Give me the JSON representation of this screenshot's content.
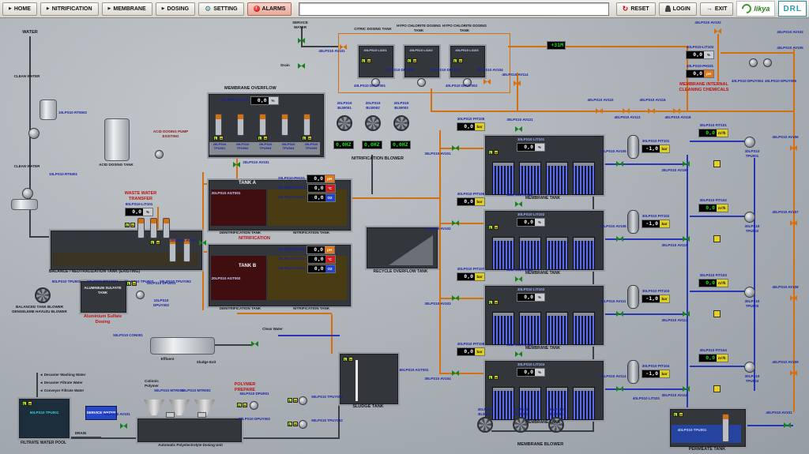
{
  "colors": {
    "pipe_orange": "#d4700f",
    "pipe_blue": "#2736b4",
    "alarm_red": "#c01010",
    "ok_green": "#18e018",
    "membrane_blue": "#5a6ae8"
  },
  "ind": {
    "l": "L",
    "h": "H"
  },
  "menubar": {
    "home": "HOME",
    "nitrification": "NITRIFICATION",
    "membrane": "MEMBRANE",
    "dosing": "DOSING",
    "setting": "SETTING",
    "alarms": "ALARMS",
    "command": "",
    "reset": "RESET",
    "login": "LOGIN",
    "exit": "EXIT",
    "brand": "likya",
    "brand2": "DRL"
  },
  "intake": {
    "water": "WATER",
    "clean_water_top": "CLEAN WATER",
    "clean_water_bottom": "CLEAN WATER",
    "rt_top": "10LPS10 RT5002",
    "rt_bottom": "10LPS10 RT5001"
  },
  "acid": {
    "tank_label": "ACID DOSING TANK",
    "pump_label": "ACID DOSING PUMP EXISTING"
  },
  "waste": {
    "title": "WASTE WATER TRANSFER",
    "lit_tag": "50LPS10-LIT101",
    "lit_value": "0,0",
    "unit": "%"
  },
  "balance": {
    "label": "BALANCE / NEUTRALIZATION TANK (EXISTING)",
    "pumps": [
      "50LPS10 TPU001",
      "50LPS10 TPUY001",
      "50LPS10 TPU002",
      "50LPS10 TPUY002"
    ],
    "blower_label": "BALANCED TANK BLOWER DENGELEME HAVUZU BLOWER"
  },
  "alum": {
    "tank_label": "ALUMINIUM SULFATE TANK",
    "dpu": "10LPS10 DPU001",
    "dpuy": "10LPS10 DPUY002",
    "title": "Aluminium Sulfate Dosing"
  },
  "overflow": {
    "title": "MEMBRANE OVERFLOW",
    "lit_tag": "20LPS10-LIT101",
    "lit_value": "0,0",
    "unit": "%",
    "pumps": [
      "20LPS10 TPU001",
      "20LPS10 TPU002",
      "20LPS10 TPU003",
      "20LPS10 TPU004",
      "20LPS10 TPU005"
    ],
    "valve": "20LPS10 AV101",
    "valve2": "20LPS10 AV102"
  },
  "bio": {
    "a": {
      "name": "TANK A",
      "agt": "20LPS10 AGT001",
      "ph_tag": "20LPS10-PH101",
      "ph": "0,0",
      "tit_tag": "20LPS10-TIT101",
      "tit": "0,0",
      "do_tag": "20LPS10-DO101",
      "dox": "0,0",
      "denit": "DENITRIFICATION TANK",
      "nit": "NITRIFICATION TANK"
    },
    "b": {
      "name": "TANK B",
      "agt": "20LPS10 AGT002",
      "ph_tag": "20LPS10-PH102",
      "ph": "0,0",
      "tit_tag": "20LPS10-TIT102",
      "tit": "0,0",
      "do_tag": "20LPS10-DO102",
      "dox": "0,0",
      "denit": "DENITRIFICATION TANK",
      "nit": "NITRIFICATION TANK"
    },
    "section": "NITRIFICATION",
    "u_ph": "pH",
    "u_c": "°C",
    "u_o2": "O2"
  },
  "nitblower": {
    "title": "NITRIFICATION BLOWER",
    "tags": [
      "20LPS10 BLW001",
      "20LPS10 BLW002",
      "20LPS10 BLW003"
    ],
    "hz": "0,0HZ"
  },
  "recycle": {
    "label": "RECYCLE OVERFLOW TANK"
  },
  "cipdose": {
    "service_water": "SERVICE WATER",
    "drain": "Drain",
    "runtime": "+31M",
    "valve_in": "40LPS10 AV101",
    "valve_out": "40LPS10 AV104",
    "valve_mid": "40LPS10 AV114",
    "tanks": [
      {
        "title": "CITRIC DOSING TANK",
        "tag": "40LPS10 L3101"
      },
      {
        "title": "HYPO CHLORITE DOSING TANK",
        "tag": "40LPS10 L3102"
      },
      {
        "title": "HYPO CHLORITE DOSING TANK",
        "tag": "40LPS10 L3103"
      }
    ],
    "dpu": [
      "40LPS10 DPU002",
      "40LPS10 DPU003"
    ],
    "dpuy": [
      "40LPS10 DPUY001",
      "40LPS10 DPUY003"
    ]
  },
  "cip": {
    "title": "MEMBRANE INTERNAL CLEANING CHEMICALS",
    "valve_top": "40LPS10 AV102",
    "lit_tag": "40LPS10-LIT102",
    "lit": "0,0",
    "u_pct": "%",
    "ph_tag": "40LPS10-PH101",
    "ph": "0,0",
    "u_ph": "pH",
    "v1": "40LPS10 AV103",
    "v2": "40LPS10 AV105",
    "dpuy1": "40LPS10 DPUY004",
    "dpuy2": "40LPS10 DPUY005",
    "line_valves": [
      "40LPS10 AV110",
      "40LPS10 AV113",
      "40LPS10 AV115",
      "40LPS10 AV116"
    ]
  },
  "mem": {
    "u_bar": "bar",
    "u_pct": "%",
    "u_flow": "m³/h",
    "rows": [
      {
        "feed": "30LPS10 AV101",
        "pit_tag": "30LPS10 PIT105",
        "pit": "0,0",
        "air": "30LPS10 AV121",
        "lit_tag": "30LPS10 LIT101",
        "lit": "0,0",
        "name": "MEMBRANE TANK",
        "ppit_tag": "30LPS10 PIT101",
        "ppit": "-1,0",
        "fit_tag": "30LPS10 FIT101",
        "flow": "0,0",
        "pump": "30LPS10 TPU001",
        "v1": "30LPS10 AV105",
        "v2": "30LPS10 AV106",
        "cipv": "40LPS10 AV106"
      },
      {
        "feed": "30LPS10 AV102",
        "pit_tag": "30LPS10 PIT106",
        "pit": "0,0",
        "air": "30LPS10 AV122",
        "lit_tag": "30LPS10 LIT102",
        "lit": "0,0",
        "name": "MEMBRANE TANK",
        "ppit_tag": "30LPS10 PIT102",
        "ppit": "-1,0",
        "fit_tag": "30LPS10 FIT102",
        "flow": "0,0",
        "pump": "30LPS10 TPU002",
        "v1": "30LPS10 AV108",
        "v2": "30LPS10 AV110",
        "cipv": "40LPS10 AV107"
      },
      {
        "feed": "30LPS10 AV103",
        "pit_tag": "30LPS10 PIT107",
        "pit": "0,0",
        "air": "30LPS10 AV123",
        "lit_tag": "30LPS10 LIT103",
        "lit": "0,0",
        "name": "MEMBRANE TANK",
        "ppit_tag": "30LPS10 PIT103",
        "ppit": "-1,0",
        "fit_tag": "30LPS10 FIT103",
        "flow": "0,0",
        "pump": "30LPS10 TPU003",
        "v1": "30LPS10 AV111",
        "v2": "30LPS10 AV113",
        "cipv": "40LPS10 AV108"
      },
      {
        "feed": "30LPS10 AV104",
        "pit_tag": "30LPS10 PIT108",
        "pit": "0,0",
        "air": "30LPS10 AV124",
        "lit_tag": "30LPS10 LIT104",
        "lit": "0,0",
        "name": "MEMBRANE TANK",
        "ppit_tag": "30LPS10 PIT104",
        "ppit": "-1,0",
        "fit_tag": "30LPS10 FIT104",
        "flow": "0,0",
        "pump": "30LPS10 TPU004",
        "v1": "30LPS10 AV114",
        "v2": "30LPS10 AV116",
        "cipv": "40LPS10 AV109"
      }
    ]
  },
  "memblower": {
    "title": "MEMBRANE BLOWER",
    "tags": [
      "30LPS10 BLW001",
      "30LPS10 BLW002",
      "30LPS10 BLW003"
    ]
  },
  "permeate": {
    "label": "PERMEATE TANK",
    "pump": "40LPS10 TPU001",
    "lit": "40LPS10 LIT101",
    "valve": "40LPS10 AV101"
  },
  "sludge": {
    "label": "SLUDGE TANK",
    "agt": "60LPS10 AGT001"
  },
  "polymer": {
    "title": "POLYMER PREPARE",
    "cationic": "Cationic Polymer",
    "mtr": [
      "50LPS10 MTR001",
      "50LPS10 MTR002"
    ],
    "dpu": "50LPS10 DPU001",
    "dpuy": "50LPS10 DPUY002",
    "tpuy": [
      "50LPS10 TPUY001",
      "50LPS10 TPUY002"
    ],
    "unit_label": "Automatic Polyelectrolyte Dosing Unit"
  },
  "decanter": {
    "con": "50LPS10 CON001",
    "effluent": "Effluent",
    "sludge_exit": "Sludge Exit",
    "clean_water": "Clean Water",
    "valve": "50LPS10 AV101"
  },
  "filtrate": {
    "in1": "◄ Decanter Washing Water",
    "in2": "◄ Decanter Filtrate Water",
    "in3": "◄ Conveyor Filtrate Water",
    "pool": "FILTRATE WATER POOL",
    "pool_tag": "50LPS10 TPU001",
    "service": "SERVICE WATER",
    "valve": "50LPS10 AV101",
    "drain": "DRAIN"
  }
}
